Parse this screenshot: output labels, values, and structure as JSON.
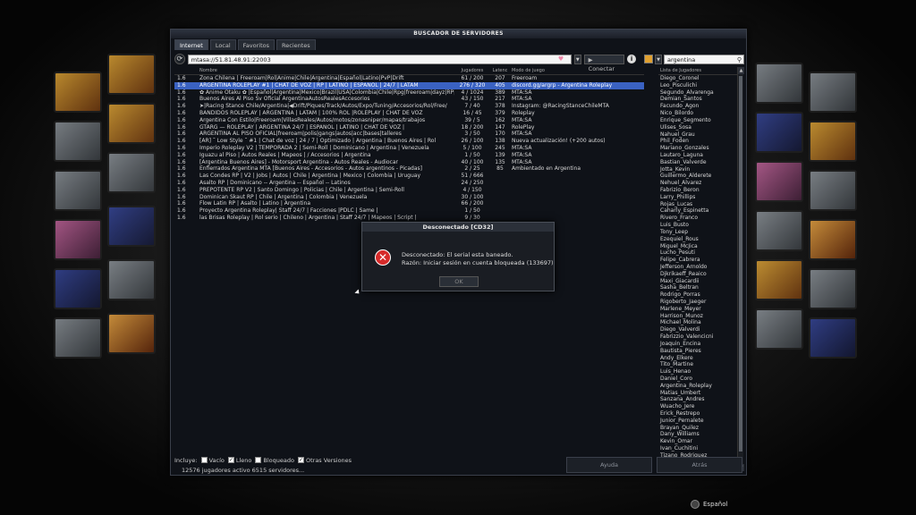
{
  "window": {
    "title": "BUSCADOR DE SERVIDORES"
  },
  "tabs": [
    "Internet",
    "Local",
    "Favoritos",
    "Recientes"
  ],
  "toolbar": {
    "address": "mtasa://51.81.48.91:22003",
    "connect_label": "Conectar",
    "search_value": "argentina"
  },
  "list_headers": {
    "name": "Nombre",
    "players": "Jugadores",
    "ping": "Latenc",
    "mode": "Modo de juego"
  },
  "servers": [
    {
      "ver": "1.6",
      "name": "Zona Chilena  | Freeroam|Rol|Anime|Chile|Argentina|Español|Latino|PvP|Drift",
      "players": "61 / 200",
      "ping": "207",
      "mode": "Freeroam"
    },
    {
      "ver": "1.6",
      "name": "ARGENTINA ROLEPLAY #1 | CHAT DE VOZ | RP | LATINO | ESPAÑOL | 24/7 | LATAM",
      "players": "276 / 320",
      "ping": "405",
      "mode": "discord.gg/argrp - Argentina Roleplay"
    },
    {
      "ver": "1.6",
      "name": "✿ Anime Otaku ✿ |Español|Argentina|Mexico|Brazil|USA|Colombia|Chile|Rpg|freeroam|dayz|RP|",
      "players": "4 / 1024",
      "ping": "389",
      "mode": "MTA:SA"
    },
    {
      "ver": "1.6",
      "name": "Buenos Aires Al Piso Sv Oficial ArgentinaAutosRealesAccesorios",
      "players": "43 / 150",
      "ping": "217",
      "mode": "MTA:SA"
    },
    {
      "ver": "1.6",
      "name": "➤|Racing Stance Chile/Argentina|◀Drift/Piques/Track/Autos/Expo/Tuning/Accesorios/Rol/Free/",
      "players": "7 / 40",
      "ping": "378",
      "mode": "Instagram: @RacingStanceChileMTA"
    },
    {
      "ver": "1.6",
      "name": "BANDIDOS ROLEPLAY | ARGENTINA | LATAM | 100% ROL |ROLEPLAY | CHAT DE VOZ",
      "players": "16 / 45",
      "ping": "379",
      "mode": "Roleplay"
    },
    {
      "ver": "1.6",
      "name": "Argentina Con Estilo|Freeroam|VillasReales/Autos/motos/zonasniper/mapas/trabajos",
      "players": "39 / 5",
      "ping": "162",
      "mode": "MTA:SA"
    },
    {
      "ver": "1.6",
      "name": "GTARG — ROLEPLAY | ARGENTINA 24/7 | ESPAÑOL | LATINO | CHAT DE VOZ |",
      "players": "18 / 200",
      "ping": "147",
      "mode": "RolePlay"
    },
    {
      "ver": "1.6",
      "name": "ARGENTINA AL PISO OFICIAL|freeroam|polis|gangs|autos|acc|bases|talleres",
      "players": "3 / 50",
      "ping": "170",
      "mode": "MTA:SA"
    },
    {
      "ver": "1.6",
      "name": "[AR] ˘ Low Style ˘ #1 | Chat de voz | 24 / 7 | Optimizado | Argentina | Buenos Aires | Rol",
      "players": "26 / 100",
      "ping": "138",
      "mode": "Nueva actualización! (+200 autos)"
    },
    {
      "ver": "1.6",
      "name": "Imperio Roleplay V2 | TEMPORADA 2 | Semi-Roll | Dominicano | Argentina | Venezuela",
      "players": "5 / 100",
      "ping": "245",
      "mode": "MTA:SA"
    },
    {
      "ver": "1.6",
      "name": "Iguazu al Piso | Autos Reales | Mapeos | / Accesorios | Argentina",
      "players": "1 / 50",
      "ping": "139",
      "mode": "MTA:SA"
    },
    {
      "ver": "1.6",
      "name": "[Argentina Buenos Aires] - Motorsport Argentina - Autos Reales - Audiocar",
      "players": "40 / 100",
      "ping": "135",
      "mode": "MTA:SA"
    },
    {
      "ver": "1.6",
      "name": "Enfierrados Argentina MTA [Buenos Aires - Accesorios - Autos argentinos - Picadas]",
      "players": "2 / 25",
      "ping": "85",
      "mode": "Ambientado en Argentina"
    },
    {
      "ver": "1.6",
      "name": "Las Condes RP | V2 | Jobs | Autos | Chile | Argentina | Mexico | Colombia | Uruguay",
      "players": "51 / 666",
      "ping": "",
      "mode": ""
    },
    {
      "ver": "1.6",
      "name": "Asalto RP | Dominicano -- Argentina -- Español -- Latinos",
      "players": "24 / 250",
      "ping": "",
      "mode": ""
    },
    {
      "ver": "1.6",
      "name": "PREPOTENTE RP V2 | Santo Domingo | Policias | Chile | Argentina | Semi-Roll",
      "players": "4 / 150",
      "ping": "",
      "mode": ""
    },
    {
      "ver": "1.6",
      "name": "Dominican Skaut RP | Chile | Argentina | Colombia | Venezuela",
      "players": "30 / 100",
      "ping": "",
      "mode": ""
    },
    {
      "ver": "1.6",
      "name": "Flow Latin RP | Asalto | Latino | Argentina",
      "players": "66 / 200",
      "ping": "",
      "mode": ""
    },
    {
      "ver": "1.6",
      "name": "Proyecto Argentina Roleplay| Staff 24/7 | Facciones |PDLC | Same |",
      "players": "1 / 50",
      "ping": "",
      "mode": ""
    },
    {
      "ver": "1.6",
      "name": "las Brisas Roleplay | Rol serio | Chileno | Argentina | Staff 24/7 | Mapeos | Script |",
      "players": "9 / 30",
      "ping": "",
      "mode": ""
    }
  ],
  "players_header": "Lista de Jugadores",
  "players": [
    "Diego_Coronel",
    "Leo_Pisculichi",
    "Segundo_Alvarenga",
    "Demian_Santos",
    "Facundo_Agon",
    "Nico_Bilordo",
    "Enrique_Segmento",
    "Ulises_Sosa",
    "Nahuel_Grau",
    "Phil_Foden",
    "Mariano_Gonzales",
    "Lautaro_Laguna",
    "Bastian_Valverde",
    "Jotta_Kevin",
    "Guillermo_Alderete",
    "Nehuel_Alvarez",
    "Fabrizio_Beron",
    "Larry_Phillips",
    "Rojas_Lucas",
    "Caharly_Espinetta",
    "Rivero_Franco",
    "Luis_Busto",
    "Tony_Leep",
    "Ezequiel_Rous",
    "Miguel_McJica",
    "Lucho_Pesuti",
    "Felipe_Cabrera",
    "Jefferson_Arnoldo",
    "Djkrikaeff_Reaico",
    "Maxi_Giacardii",
    "Sasha_Beltran",
    "Rodrigo_Porras",
    "Rigoberto_Jaeger",
    "Marlene_Meyer",
    "Harrison_Munoz",
    "Michael_Molina",
    "Diego_Valverdi",
    "Fabrizzio_Valencicni",
    "Joaquin_Encina",
    "Bautista_Pieres",
    "Andy_Elkere",
    "Tito_Martine",
    "Luis_Henao",
    "Daniel_Coro",
    "Argentina_Roleplay",
    "Matias_Umbert",
    "Sanzana_Andres",
    "Wuacho_Jere",
    "Erick_Restrepo",
    "Junior_Pernalete",
    "Brayan_Quilez",
    "Dany_Williams",
    "Kevin_Omar",
    "Ivan_Cuchitini",
    "Tizano_Rodriguez"
  ],
  "footer": {
    "include_label": "Incluye:",
    "checkboxes": [
      {
        "label": "Vacío",
        "checked": false
      },
      {
        "label": "Lleno",
        "checked": true
      },
      {
        "label": "Bloqueado",
        "checked": false
      },
      {
        "label": "Otras Versiones",
        "checked": true
      }
    ],
    "status": "12576 jugadores activo 6515 servidores...",
    "help_label": "Ayuda",
    "back_label": "Atrás"
  },
  "dialog": {
    "title": "Desconectado [CD32]",
    "line1": "Desconectado: El serial esta baneado.",
    "line2": "Razón: Iniciar sesión en cuenta bloqueada (133697)",
    "ok_label": "OK"
  },
  "language": "Español"
}
